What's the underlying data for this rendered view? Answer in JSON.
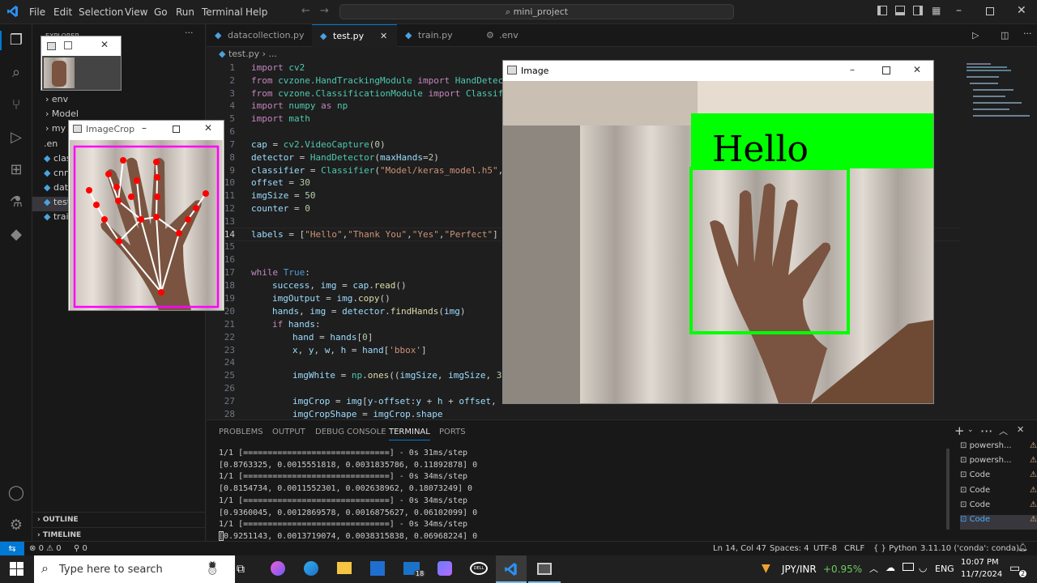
{
  "app": {
    "menu": [
      "File",
      "Edit",
      "Selection",
      "View",
      "Go",
      "Run",
      "Terminal",
      "Help"
    ],
    "search_text": "mini_project"
  },
  "sidebar": {
    "header": "EXPLORER",
    "items": [
      "env",
      "Model",
      "my",
      ".en",
      "clas",
      "cnn",
      "dat",
      "test",
      "trai"
    ],
    "outline": "OUTLINE",
    "timeline": "TIMELINE"
  },
  "tabs": [
    {
      "label": "datacollection.py",
      "active": false
    },
    {
      "label": "test.py",
      "active": true
    },
    {
      "label": "train.py",
      "active": false
    },
    {
      "label": ".env",
      "active": false
    }
  ],
  "breadcrumb": {
    "file": "test.py",
    "rest": "..."
  },
  "code": {
    "line_numbers": [
      "1",
      "2",
      "3",
      "4",
      "5",
      "6",
      "7",
      "8",
      "9",
      "10",
      "11",
      "12",
      "13",
      "14",
      "15",
      "16",
      "17",
      "18",
      "19",
      "20",
      "21",
      "22",
      "23",
      "24",
      "25",
      "26",
      "27",
      "28"
    ]
  },
  "panel": {
    "tabs": [
      "PROBLEMS",
      "OUTPUT",
      "DEBUG CONSOLE",
      "TERMINAL",
      "PORTS"
    ],
    "active_tab": "TERMINAL",
    "terminal_lines": [
      "1/1 [==============================] - 0s 31ms/step",
      "[0.8763325, 0.0015551818, 0.0031835786, 0.11892878] 0",
      "1/1 [==============================] - 0s 34ms/step",
      "[0.8154734, 0.0011552301, 0.002638962, 0.18073249] 0",
      "1/1 [==============================] - 0s 34ms/step",
      "[0.9360045, 0.0012869578, 0.0016875627, 0.06102099] 0",
      "1/1 [==============================] - 0s 34ms/step",
      "[0.9251143, 0.0013719074, 0.0038315838, 0.06968224] 0"
    ],
    "terminal_list": [
      "powersh...",
      "powersh...",
      "Code",
      "Code",
      "Code",
      "Code"
    ]
  },
  "status": {
    "errors": "0",
    "warnings": "0",
    "ports": "0",
    "position": "Ln 14, Col 47",
    "spaces": "Spaces: 4",
    "encoding": "UTF-8",
    "eol": "CRLF",
    "language": "Python",
    "interpreter": "3.11.10 ('conda': conda)"
  },
  "windows": {
    "image_title": "Image",
    "imagecrop_title": "ImageCrop",
    "prediction_label": "Hello"
  },
  "taskbar": {
    "search_placeholder": "Type here to search",
    "mail_badge": "18",
    "stock": "JPY/INR",
    "stock_change": "+0.95%",
    "lang": "ENG",
    "time": "10:07 PM",
    "date": "11/7/2024",
    "notif_count": "2"
  },
  "colors": {
    "accent": "#0078d4",
    "hand_box": "#00ff00",
    "crop_box": "#ff00ff",
    "landmark": "#ff0000"
  }
}
